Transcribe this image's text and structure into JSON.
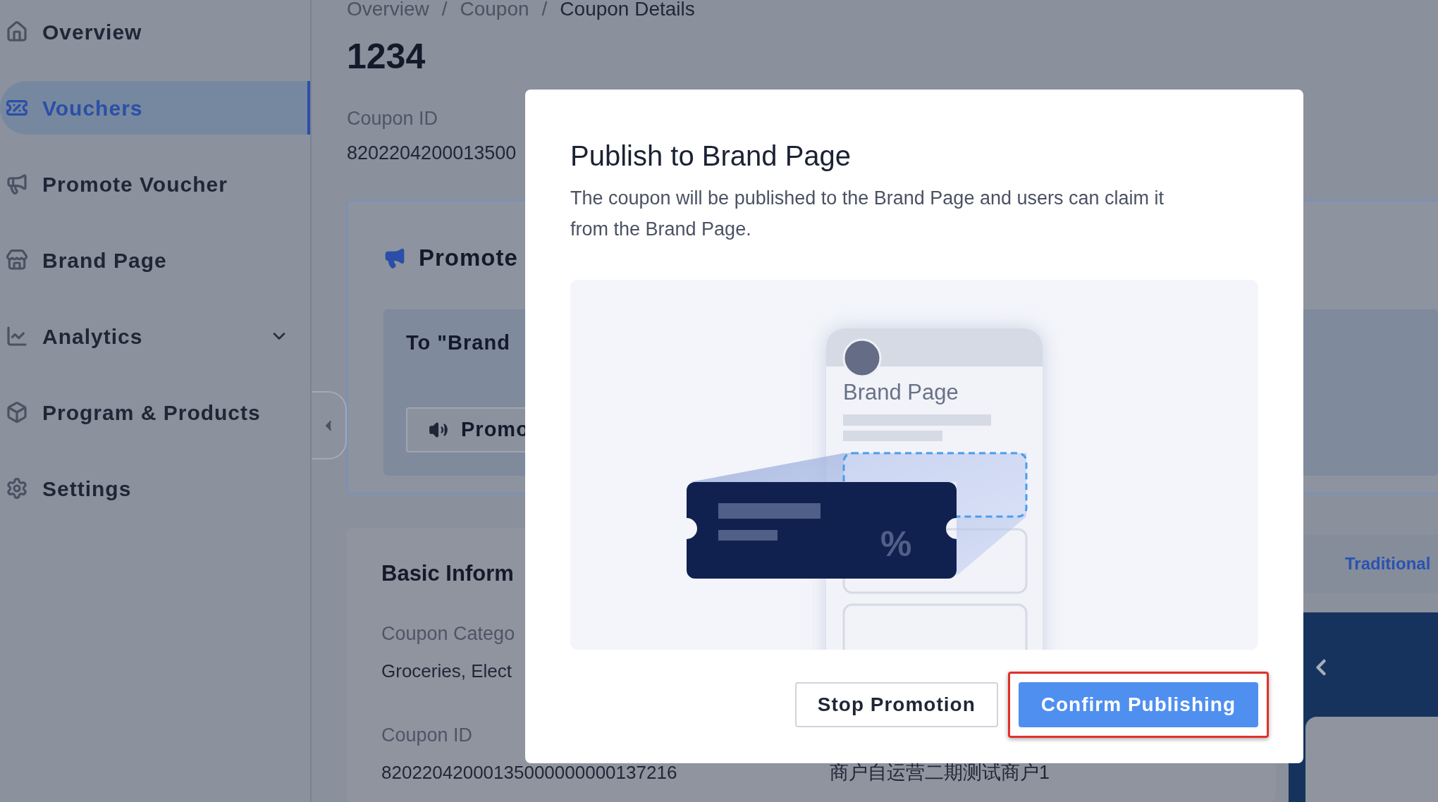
{
  "sidebar": {
    "items": [
      {
        "label": "Overview",
        "kind": "link",
        "selected": false
      },
      {
        "label": "Vouchers",
        "kind": "link",
        "selected": true
      },
      {
        "label": "Promote Voucher",
        "kind": "link",
        "selected": false
      },
      {
        "label": "Brand Page",
        "kind": "link",
        "selected": false
      },
      {
        "label": "Analytics",
        "kind": "group",
        "selected": false,
        "expanded": false
      },
      {
        "label": "Program & Products",
        "kind": "link",
        "selected": false
      },
      {
        "label": "Settings",
        "kind": "link",
        "selected": false
      }
    ]
  },
  "breadcrumb": {
    "separator": "/",
    "items": [
      "Overview",
      "Coupon",
      "Coupon Details"
    ]
  },
  "page": {
    "title": "1234",
    "id_label": "Coupon ID",
    "id_value": "8202204200013500"
  },
  "promote_card": {
    "title": "Promote",
    "target_title": "To \"Brand",
    "button": "Promo"
  },
  "basic_info": {
    "title": "Basic Inform",
    "fields": [
      {
        "label": "Coupon Catego",
        "value": "Groceries, Elect"
      },
      {
        "label": "Coupon ID",
        "value": "82022042000135000000000137216"
      }
    ],
    "extra_value": "商户自运营二期测试商户1"
  },
  "right_panel": {
    "tab": "Traditional"
  },
  "modal": {
    "title": "Publish to Brand Page",
    "description": "The coupon will be published to the Brand Page and users can claim it from the Brand Page.",
    "illustration_label": "Brand Page",
    "ticket_symbol": "%",
    "buttons": [
      {
        "label": "Stop Promotion",
        "kind": "secondary",
        "highlighted": false
      },
      {
        "label": "Confirm Publishing",
        "kind": "primary",
        "highlighted": true
      }
    ]
  }
}
